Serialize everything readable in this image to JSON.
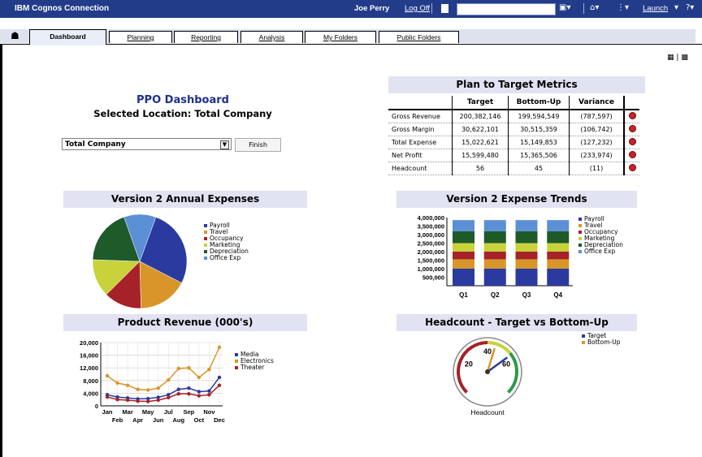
{
  "header": {
    "app_title": "IBM Cognos Connection",
    "user_name": "Joe Perry",
    "logoff_label": "Log Off",
    "search_value": "",
    "launch_label": "Launch"
  },
  "tabs": [
    {
      "label": "Dashboard",
      "active": true
    },
    {
      "label": "Planning"
    },
    {
      "label": "Reporting"
    },
    {
      "label": "Analysis"
    },
    {
      "label": "My Folders"
    },
    {
      "label": "Public Folders"
    }
  ],
  "dashboard": {
    "title": "PPO Dashboard",
    "subtitle": "Selected Location: Total Company",
    "location_select": "Total Company",
    "finish_label": "Finish"
  },
  "metrics": {
    "title": "Plan to Target Metrics",
    "headers": [
      "",
      "Target",
      "Bottom-Up",
      "Variance"
    ],
    "rows": [
      [
        "Gross Revenue",
        "200,382,146",
        "199,594,549",
        "(787,597)"
      ],
      [
        "Gross Margin",
        "30,622,101",
        "30,515,359",
        "(106,742)"
      ],
      [
        "Total Expense",
        "15,022,621",
        "15,149,853",
        "(127,232)"
      ],
      [
        "Net Profit",
        "15,599,480",
        "15,365,506",
        "(233,974)"
      ],
      [
        "Headcount",
        "56",
        "45",
        "(11)"
      ]
    ],
    "status_color": "#c5262a"
  },
  "panels": {
    "annual_expenses": "Version 2 Annual Expenses",
    "expense_trends": "Version 2 Expense Trends",
    "product_revenue": "Product Revenue (000's)",
    "headcount": "Headcount - Target vs Bottom-Up"
  },
  "chart_data": [
    {
      "type": "pie",
      "title": "Version 2 Annual Expenses",
      "labels": [
        "Payroll",
        "Travel",
        "Occupancy",
        "Marketing",
        "Depreciation",
        "Office Exp"
      ],
      "values": [
        27,
        17,
        13,
        13,
        19,
        11
      ],
      "colors": [
        "#2b3a9e",
        "#d8962a",
        "#a52228",
        "#c8d23a",
        "#1e5a2a",
        "#5b8fd6"
      ],
      "legend": "right"
    },
    {
      "type": "bar",
      "stacked": true,
      "title": "Version 2 Expense Trends",
      "categories": [
        "Q1",
        "Q2",
        "Q3",
        "Q4"
      ],
      "series": [
        {
          "name": "Payroll",
          "values": [
            1000000,
            1000000,
            1000000,
            1000000
          ],
          "color": "#2b3a9e"
        },
        {
          "name": "Travel",
          "values": [
            550000,
            550000,
            550000,
            550000
          ],
          "color": "#d8962a"
        },
        {
          "name": "Occupancy",
          "values": [
            450000,
            450000,
            450000,
            450000
          ],
          "color": "#a52228"
        },
        {
          "name": "Marketing",
          "values": [
            500000,
            500000,
            500000,
            500000
          ],
          "color": "#c8d23a"
        },
        {
          "name": "Depreciation",
          "values": [
            700000,
            700000,
            700000,
            700000
          ],
          "color": "#1e5a2a"
        },
        {
          "name": "Office Exp",
          "values": [
            650000,
            650000,
            650000,
            650000
          ],
          "color": "#5b8fd6"
        }
      ],
      "y_ticks": [
        "4,000,000",
        "3,500,000",
        "3,000,000",
        "2,500,000",
        "2,000,000",
        "1,500,000",
        "1,000,000",
        "500,000"
      ],
      "ylim": [
        0,
        4000000
      ],
      "legend": "right"
    },
    {
      "type": "line",
      "title": "Product Revenue (000's)",
      "categories": [
        "Jan",
        "Feb",
        "Mar",
        "Apr",
        "May",
        "Jun",
        "Jul",
        "Aug",
        "Sep",
        "Oct",
        "Nov",
        "Dec"
      ],
      "series": [
        {
          "name": "Media",
          "values": [
            3500,
            2800,
            2500,
            2200,
            2300,
            2700,
            3500,
            5200,
            5600,
            4500,
            4700,
            9000
          ],
          "color": "#2b3a9e"
        },
        {
          "name": "Electronics",
          "values": [
            9500,
            7200,
            6500,
            5200,
            5000,
            5600,
            8200,
            11800,
            12000,
            9000,
            11500,
            18500
          ],
          "color": "#d8962a"
        },
        {
          "name": "Theater",
          "values": [
            2800,
            2000,
            1800,
            1500,
            1400,
            1800,
            2600,
            3800,
            3800,
            3200,
            3500,
            6500
          ],
          "color": "#a52228"
        }
      ],
      "y_ticks": [
        "20,000",
        "16,000",
        "12,000",
        "8,000",
        "4,000",
        "0"
      ],
      "x_top": [
        "Jan",
        "Mar",
        "May",
        "Jul",
        "Sep",
        "Nov"
      ],
      "x_bottom": [
        "Feb",
        "Apr",
        "Jun",
        "Aug",
        "Oct",
        "Dec"
      ],
      "ylim": [
        0,
        20000
      ],
      "grid": true,
      "legend": "right"
    },
    {
      "type": "gauge",
      "title": "Headcount - Target vs Bottom-Up",
      "label": "Headcount",
      "ticks": [
        "20",
        "40",
        "60"
      ],
      "series": [
        {
          "name": "Target",
          "value": 56,
          "color": "#2b3a9e"
        },
        {
          "name": "Bottom-Up",
          "value": 45,
          "color": "#d8962a"
        }
      ],
      "legend": "top-right"
    }
  ]
}
